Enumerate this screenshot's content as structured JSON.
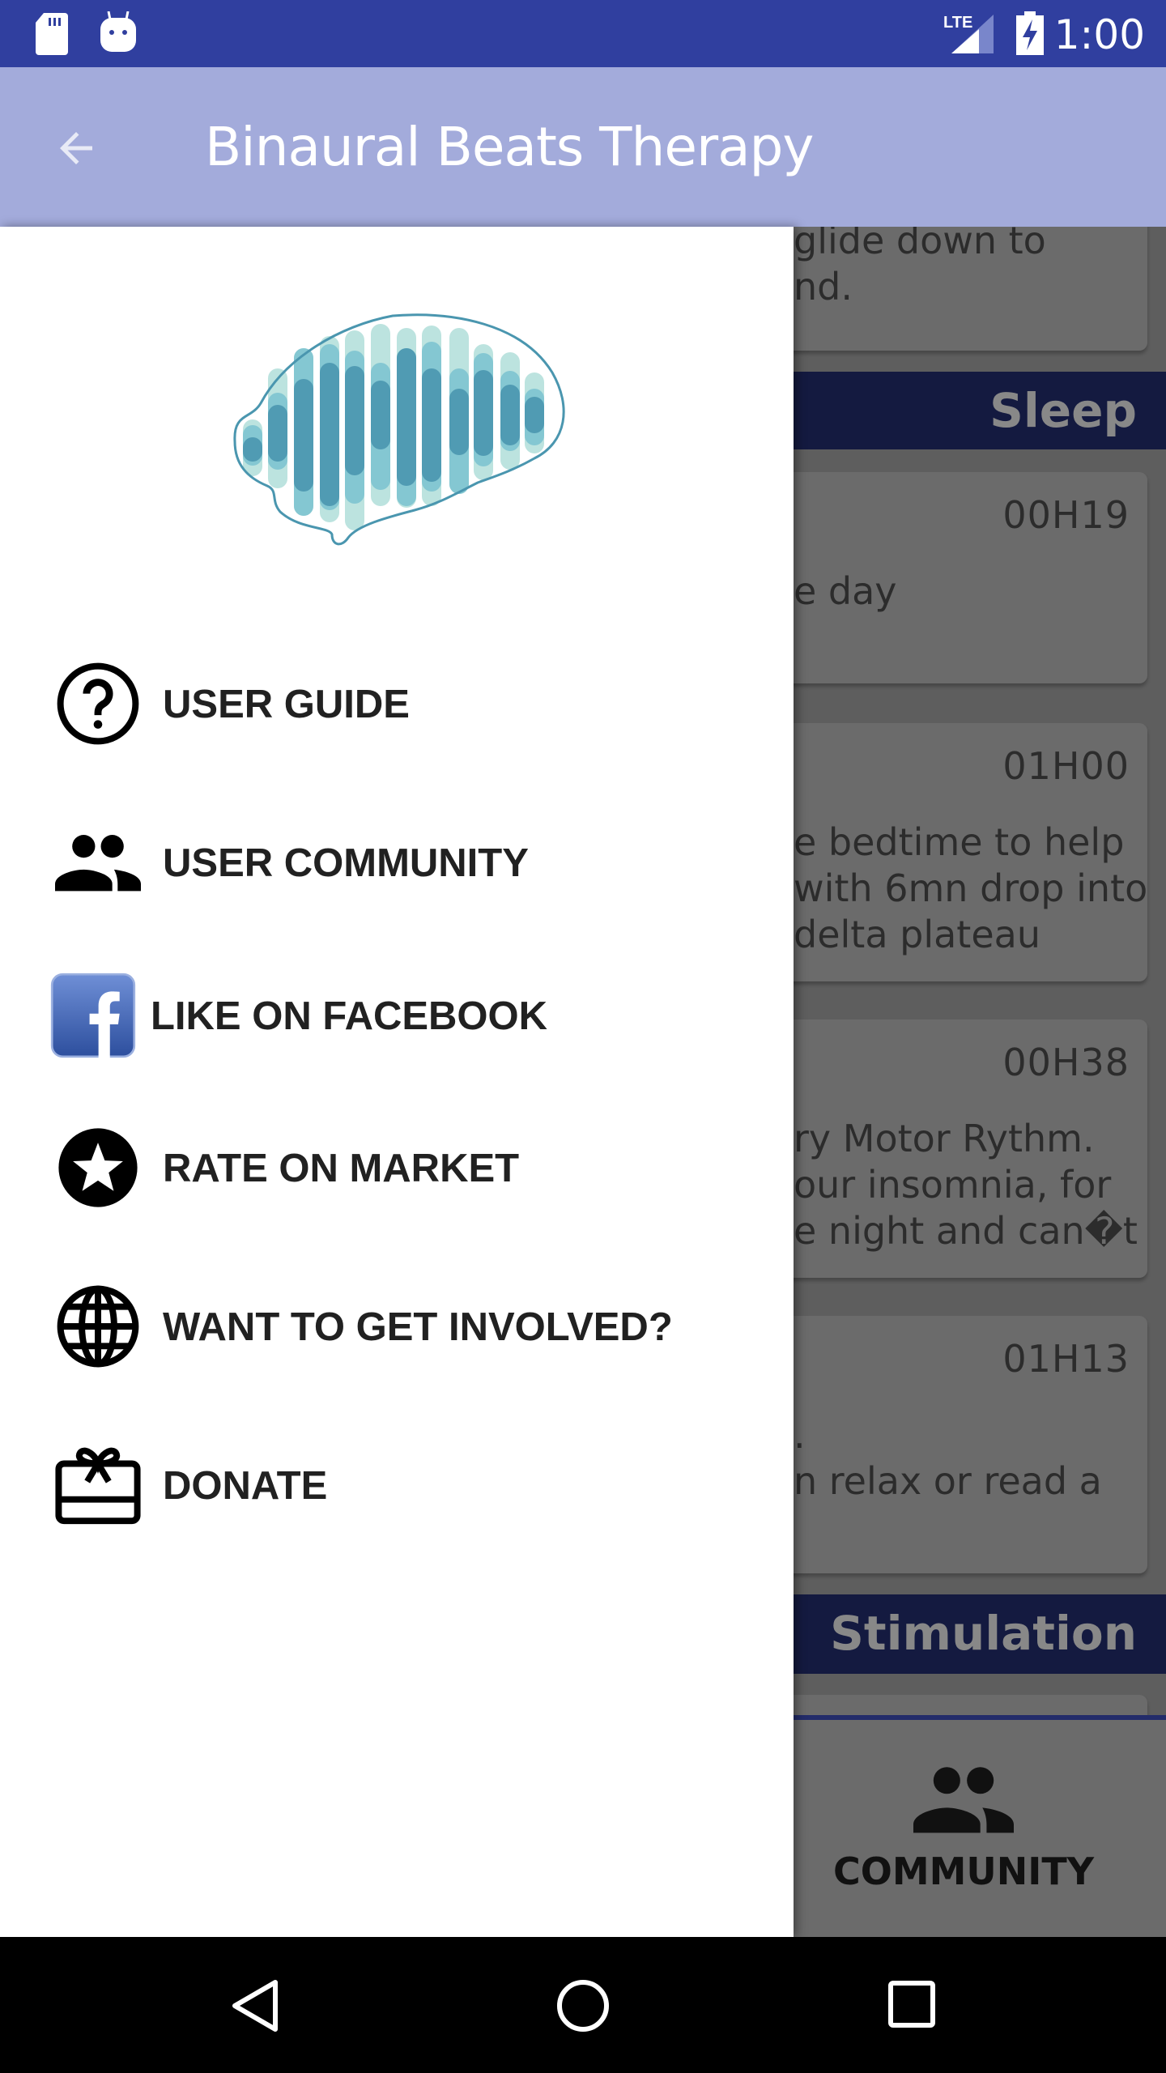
{
  "status_bar": {
    "time": "1:00",
    "network": "LTE",
    "icons": [
      "sd-card-icon",
      "android-icon",
      "lte-signal-icon",
      "battery-charging-icon"
    ]
  },
  "app_bar": {
    "title": "Binaural Beats Therapy",
    "back_icon": "arrow-back-icon"
  },
  "drawer": {
    "logo": "brain-soundwave-logo",
    "items": [
      {
        "label": "USER GUIDE",
        "icon": "help-circle-icon"
      },
      {
        "label": "USER COMMUNITY",
        "icon": "people-icon"
      },
      {
        "label": "LIKE ON FACEBOOK",
        "icon": "facebook-icon"
      },
      {
        "label": "RATE ON MARKET",
        "icon": "star-circle-icon"
      },
      {
        "label": "WANT TO GET INVOLVED?",
        "icon": "globe-icon"
      },
      {
        "label": "DONATE",
        "icon": "gift-card-icon"
      }
    ]
  },
  "content": {
    "card_partial": {
      "lines": [
        "glide down to",
        "nd."
      ]
    },
    "section_sleep": "Sleep",
    "cards": [
      {
        "duration": "00H19",
        "lines": [
          "e day"
        ]
      },
      {
        "duration": "01H00",
        "lines": [
          "e bedtime to help",
          "with 6mn drop into",
          " delta plateau"
        ]
      },
      {
        "duration": "00H38",
        "lines": [
          "ry Motor Rythm.",
          "our insomnia, for",
          "e night and can�t"
        ]
      },
      {
        "duration": "01H13",
        "lines": [
          ".",
          "n relax or read a"
        ]
      }
    ],
    "section_stimulation": "Stimulation"
  },
  "bottom_nav": {
    "label": "COMMUNITY",
    "icon": "people-icon"
  },
  "colors": {
    "primary": "#303f9f",
    "app_bar": "#a3abdb",
    "logo_dark": "#4a96af",
    "logo_mid": "#7dc3d0",
    "logo_light": "#b5e0dc"
  }
}
